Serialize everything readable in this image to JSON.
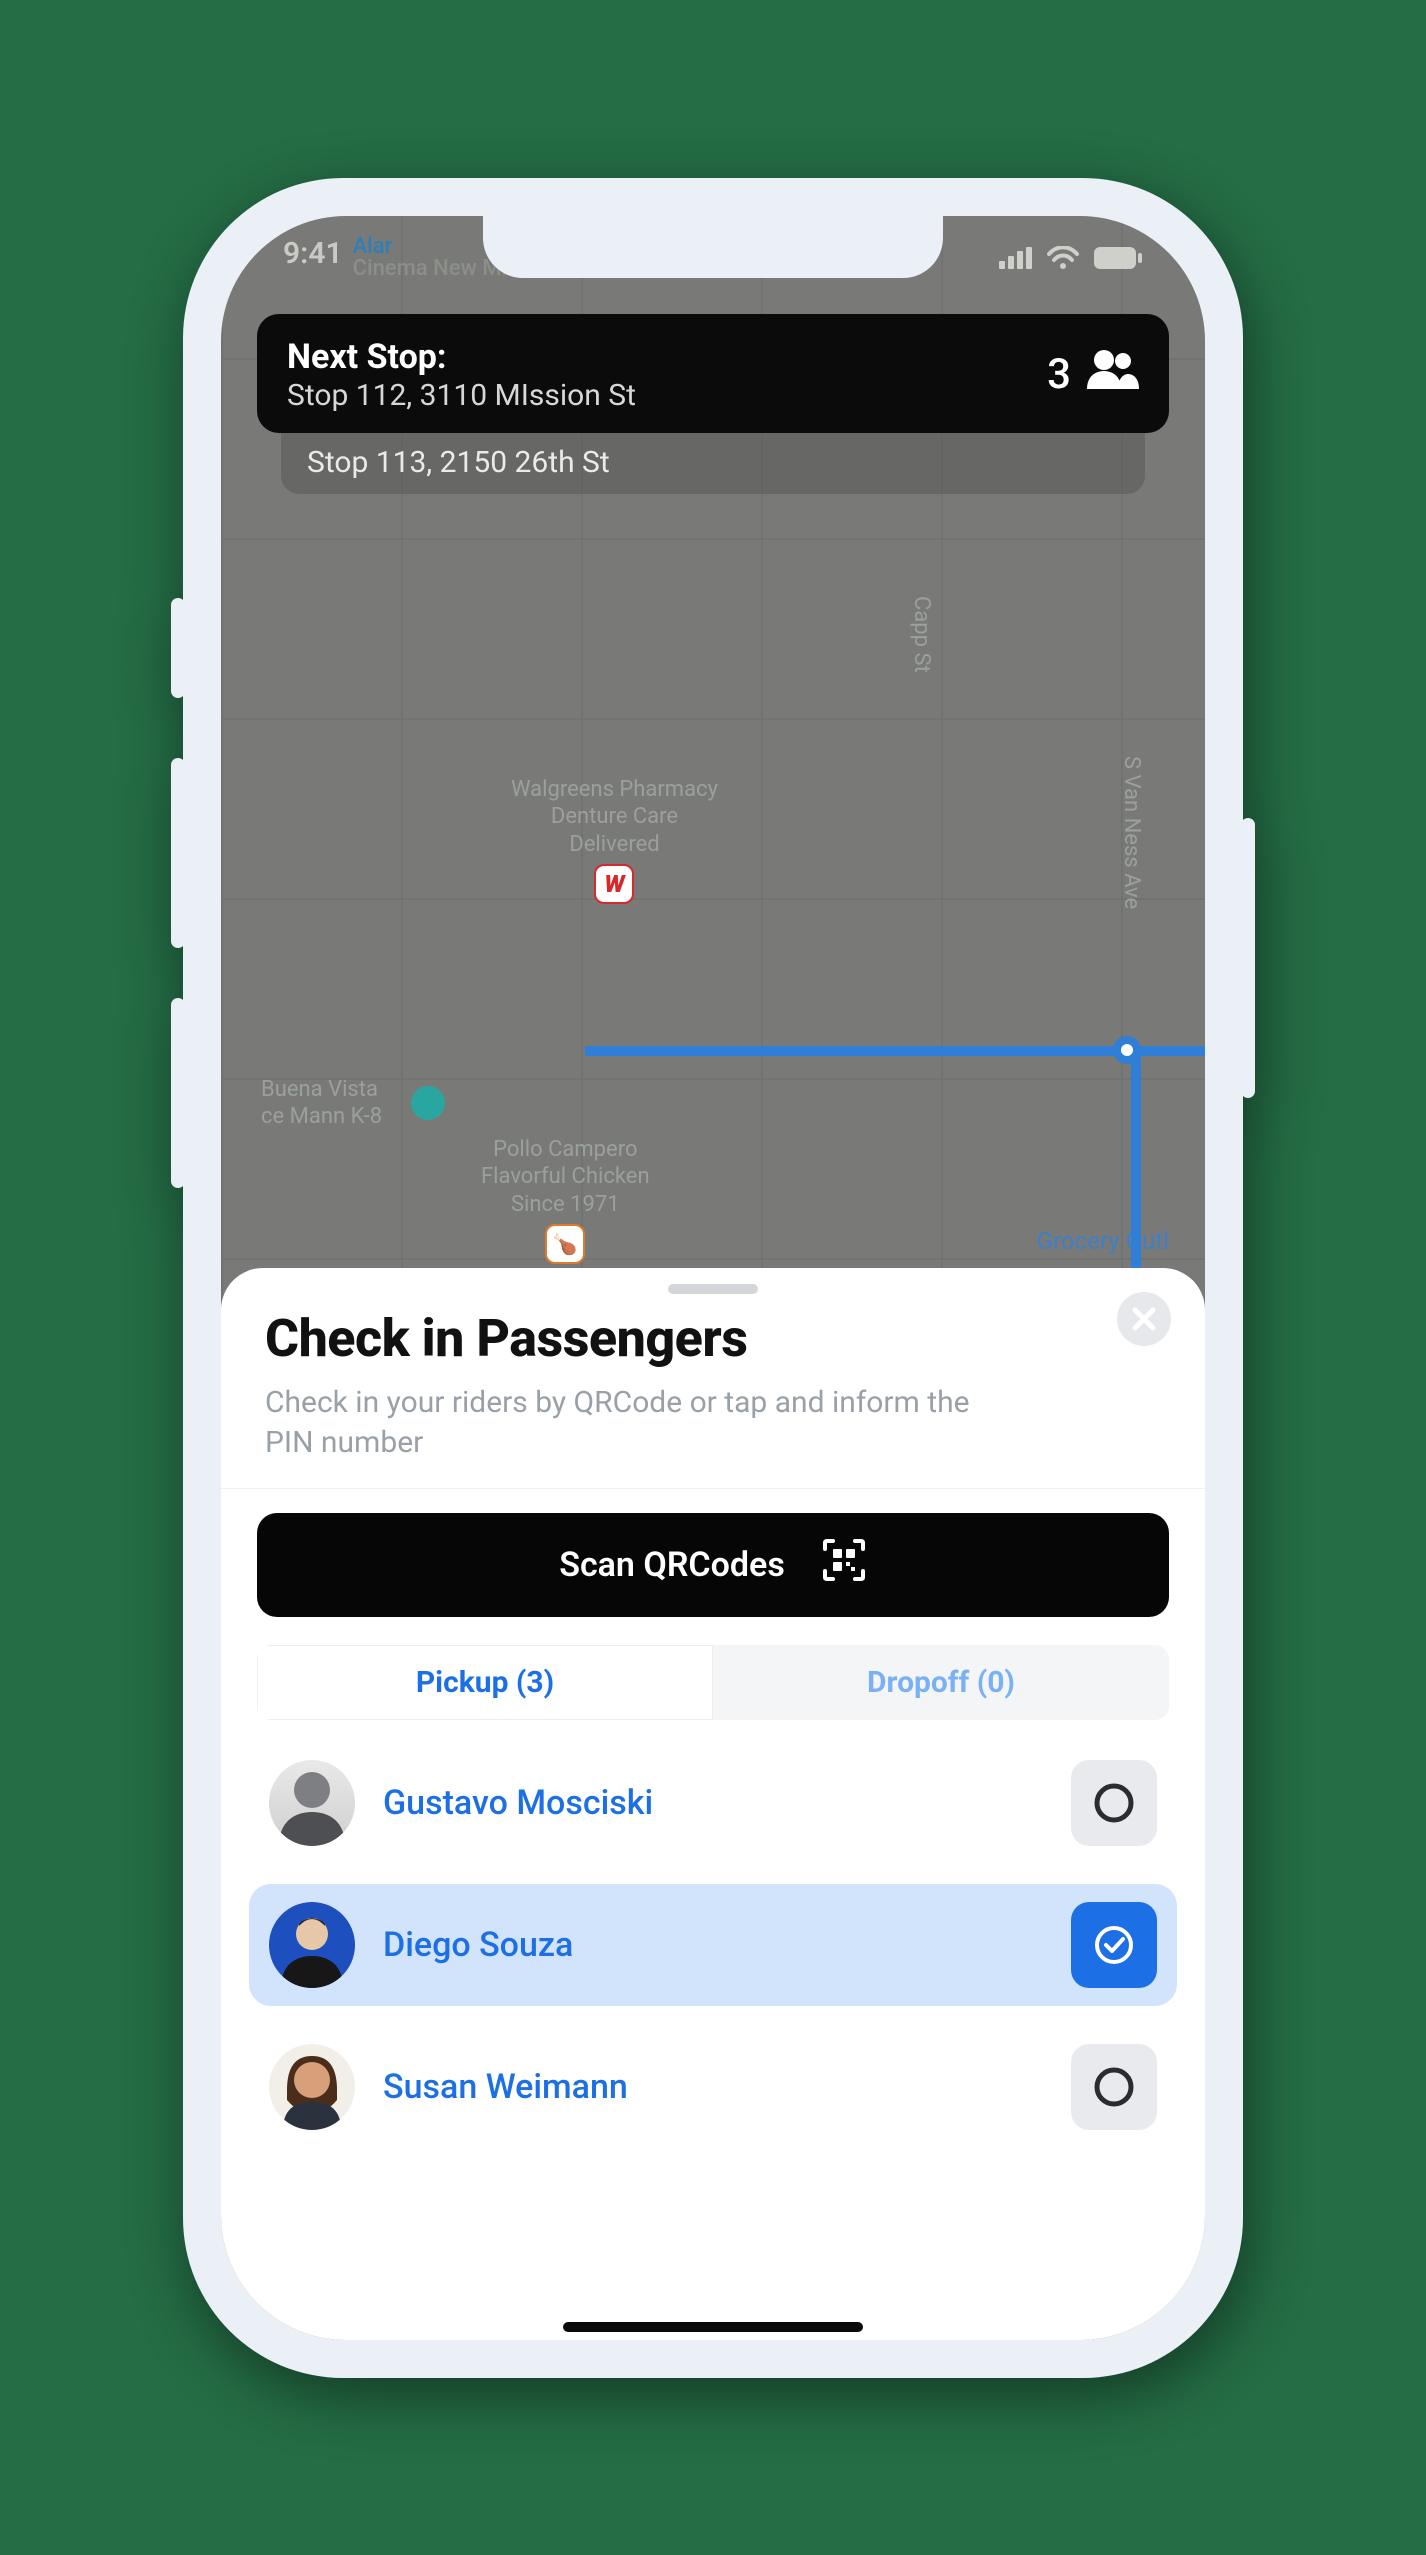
{
  "status_bar": {
    "time": "9:41"
  },
  "map": {
    "poi_top_a": "Alar",
    "poi_top_b": "Cinema New Mission",
    "walgreens_l1": "Walgreens Pharmacy",
    "walgreens_l2": "Denture Care",
    "walgreens_l3": "Delivered",
    "buena_l1": "Buena Vista",
    "buena_l2": "ce Mann K-8",
    "campero_l1": "Pollo Campero",
    "campero_l2": "Flavorful Chicken",
    "campero_l3": "Since 1971",
    "capp": "Capp St",
    "van_ness": "S Van Ness Ave",
    "grocery": "Grocery Outl"
  },
  "next_stop": {
    "label": "Next Stop:",
    "address": "Stop 112, 3110 MIssion St",
    "passenger_count": "3",
    "upcoming": "Stop 113, 2150 26th St"
  },
  "sheet": {
    "title": "Check in Passengers",
    "subtitle": "Check in your riders by QRCode or tap and inform the PIN number",
    "scan_label": "Scan QRCodes",
    "tabs": {
      "pickup": "Pickup (3)",
      "dropoff": "Dropoff (0)"
    },
    "passengers": [
      {
        "name": "Gustavo Mosciski",
        "selected": false
      },
      {
        "name": "Diego Souza",
        "selected": true
      },
      {
        "name": "Susan Weimann",
        "selected": false
      }
    ]
  }
}
